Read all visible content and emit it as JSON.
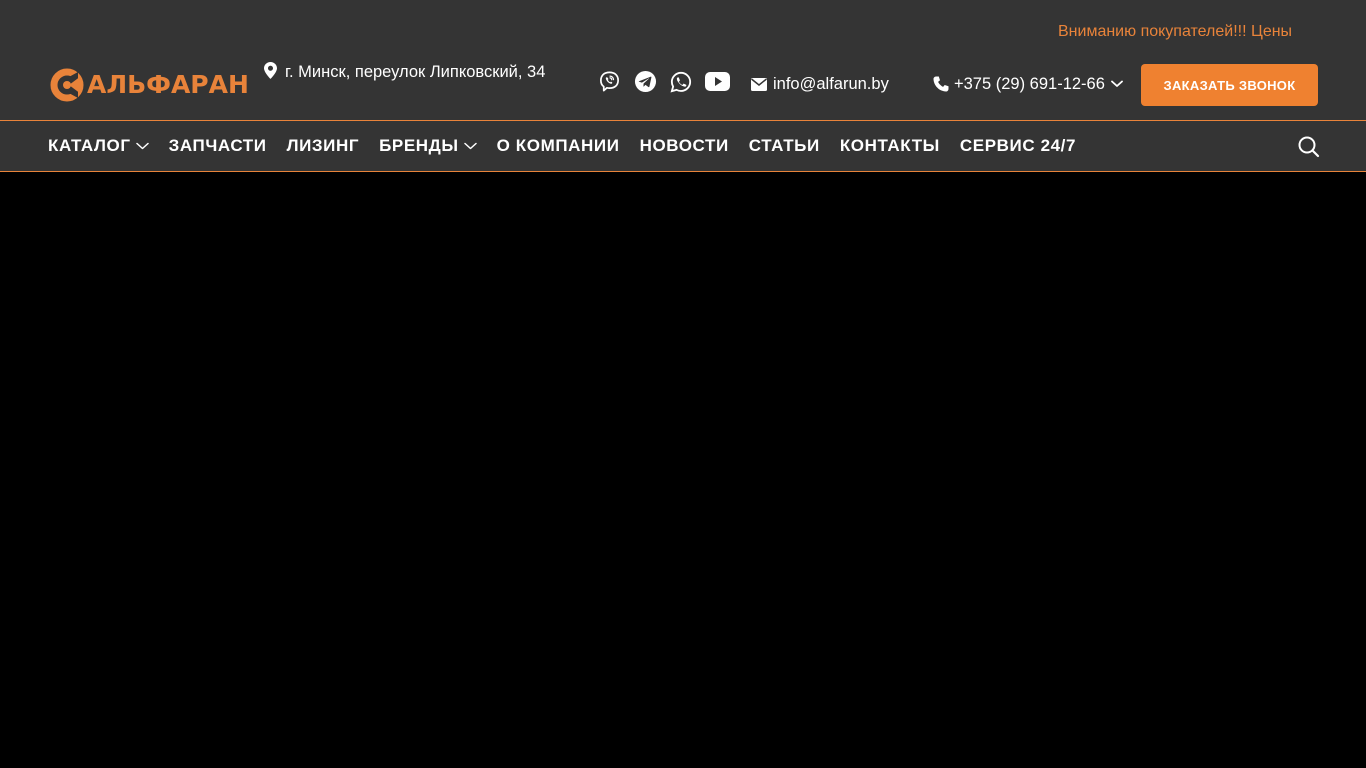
{
  "announcement": {
    "text": "Вниманию покупателей!!! Цены"
  },
  "brand": {
    "name": "АЛЬФАРАН",
    "accent_color": "#e8833a",
    "button_color": "#ef8130",
    "header_bg": "#343434"
  },
  "contacts": {
    "address": "г. Минск, переулок Липковский, 34",
    "email": "info@alfarun.by",
    "phone": "+375 (29) 691-12-66"
  },
  "socials": [
    {
      "icon": "viber-icon"
    },
    {
      "icon": "telegram-icon"
    },
    {
      "icon": "whatsapp-icon"
    },
    {
      "icon": "youtube-icon"
    }
  ],
  "callback_button": {
    "label": "ЗАКАЗАТЬ ЗВОНОК"
  },
  "nav": {
    "items": [
      {
        "label": "КАТАЛОГ",
        "has_dropdown": true
      },
      {
        "label": "ЗАПЧАСТИ",
        "has_dropdown": false
      },
      {
        "label": "ЛИЗИНГ",
        "has_dropdown": false
      },
      {
        "label": "БРЕНДЫ",
        "has_dropdown": true
      },
      {
        "label": "О КОМПАНИИ",
        "has_dropdown": false
      },
      {
        "label": "НОВОСТИ",
        "has_dropdown": false
      },
      {
        "label": "СТАТЬИ",
        "has_dropdown": false
      },
      {
        "label": "КОНТАКТЫ",
        "has_dropdown": false
      },
      {
        "label": "СЕРВИС 24/7",
        "has_dropdown": false
      }
    ]
  }
}
